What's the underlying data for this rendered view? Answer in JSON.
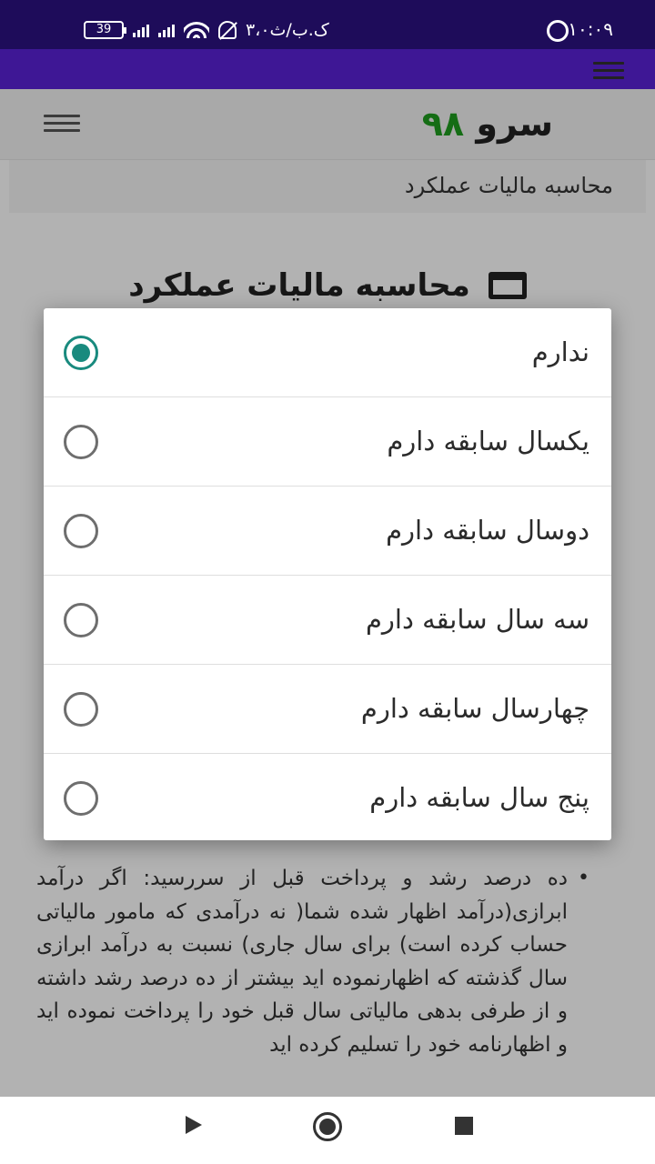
{
  "status_bar": {
    "time": "۱۰:۰۹",
    "carrier_text": "۳،۰ک.ب/ث",
    "battery_level": "39"
  },
  "page": {
    "logo_word": "سرو",
    "logo_number": "۹۸",
    "breadcrumb": "محاسبه مالیات عملکرد",
    "heading": "محاسبه مالیات عملکرد",
    "info_text": "ده درصد رشد و پرداخت قبل از سررسید: اگر درآمد ابرازی(درآمد اظهار شده شما( نه درآمدی که مامور مالیاتی حساب کرده است) برای سال جاری) نسبت به درآمد ابرازی سال گذشته که اظهارنموده اید بیشتر از ده درصد رشد داشته و از طرفی بدهی مالیاتی سال قبل خود را پرداخت نموده اید و اظهارنامه خود را تسلیم کرده اید"
  },
  "dialog": {
    "selected_index": 0,
    "options": [
      {
        "label": "ندارم"
      },
      {
        "label": "یکسال سابقه دارم"
      },
      {
        "label": "دوسال سابقه دارم"
      },
      {
        "label": "سه سال سابقه دارم"
      },
      {
        "label": "چهارسال سابقه دارم"
      },
      {
        "label": "پنج سال سابقه دارم"
      }
    ]
  },
  "colors": {
    "status_bar": "#1e0c5a",
    "app_bar": "#3e1795",
    "radio_accent": "#198a7e",
    "logo_number": "#1f9d1f"
  },
  "icons": {
    "app_bar_menu": "hamburger-icon",
    "page_heading": "window-icon",
    "nav_back": "triangle-back-icon",
    "nav_home": "circle-home-icon",
    "nav_recent": "square-recents-icon"
  }
}
